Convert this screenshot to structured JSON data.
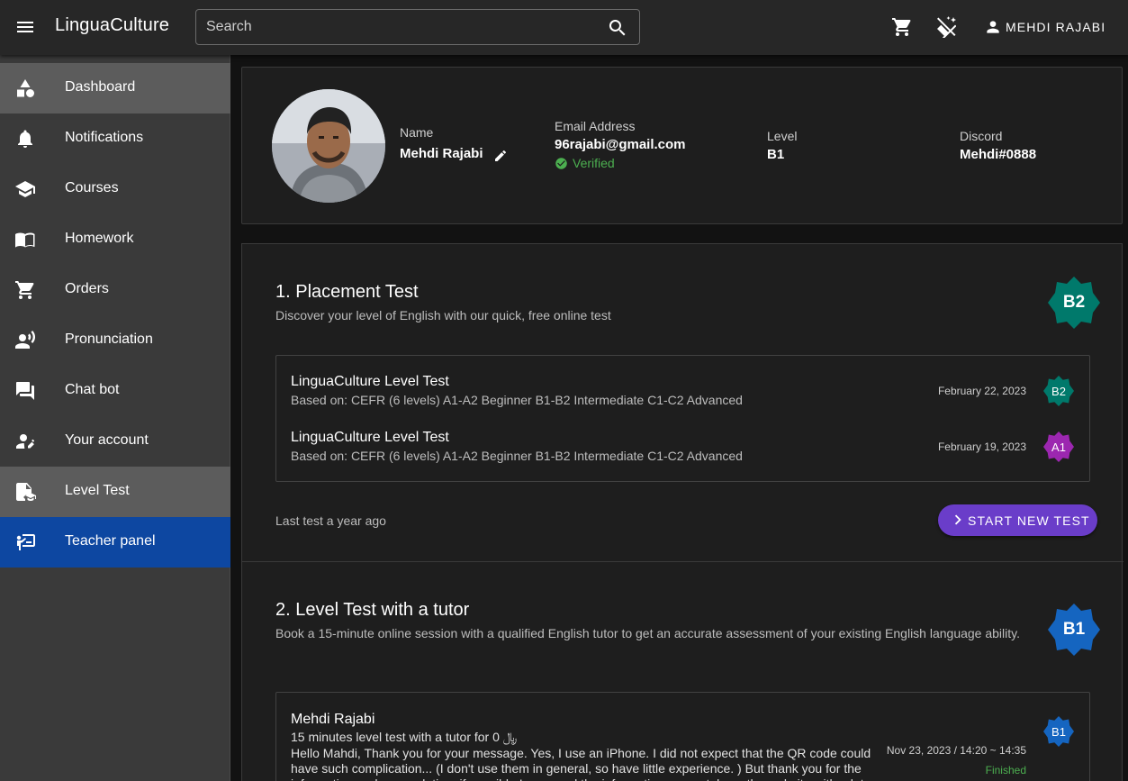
{
  "app": {
    "brand": "LinguaCulture"
  },
  "topbar": {
    "search_placeholder": "Search",
    "user_label": "MEHDI RAJABI"
  },
  "sidebar": {
    "items": [
      {
        "label": "Dashboard",
        "icon": "shapes-icon"
      },
      {
        "label": "Notifications",
        "icon": "bell-icon"
      },
      {
        "label": "Courses",
        "icon": "school-icon"
      },
      {
        "label": "Homework",
        "icon": "book-icon"
      },
      {
        "label": "Orders",
        "icon": "cart-icon"
      },
      {
        "label": "Pronunciation",
        "icon": "voice-icon"
      },
      {
        "label": "Chat bot",
        "icon": "forum-icon"
      },
      {
        "label": "Your account",
        "icon": "person-edit-icon"
      },
      {
        "label": "Level Test",
        "icon": "level-test-icon"
      },
      {
        "label": "Teacher panel",
        "icon": "teacher-icon"
      }
    ]
  },
  "profile": {
    "name_label": "Name",
    "name": "Mehdi Rajabi",
    "email_label": "Email Address",
    "email": "96rajabi@gmail.com",
    "verified": "Verified",
    "level_label": "Level",
    "level": "B1",
    "discord_label": "Discord",
    "discord": "Mehdi#0888"
  },
  "placement": {
    "title": "1. Placement Test",
    "subtitle": "Discover your level of English with our quick, free online test",
    "badge": "B2",
    "tests": [
      {
        "title": "LinguaCulture Level Test",
        "sub": "Based on: CEFR (6 levels) A1-A2 Beginner B1-B2 Intermediate C1-C2 Advanced",
        "date": "February 22, 2023",
        "level": "B2",
        "color": "#00796b"
      },
      {
        "title": "LinguaCulture Level Test",
        "sub": "Based on: CEFR (6 levels) A1-A2 Beginner B1-B2 Intermediate C1-C2 Advanced",
        "date": "February 19, 2023",
        "level": "A1",
        "color": "#9c27b0"
      }
    ],
    "last_test": "Last test a year ago",
    "start_button": "START NEW TEST"
  },
  "tutor": {
    "title": "2. Level Test with a tutor",
    "subtitle": "Book a 15-minute online session with a qualified English tutor to get an accurate assessment of your existing English language ability.",
    "badge": "B1",
    "session": {
      "name": "Mehdi Rajabi",
      "desc": "15 minutes level test with a tutor for 0 ﷼",
      "message": "Hello Mahdi, Thank you for your message. Yes, I use an iPhone. I did not expect that the QR code could have such complication... (I don't use them in general, so have little experience. ) But thank you for the information and your solution, if possible I can send the information separately on the website with a lot of thanks.",
      "datetime": "Nov 23, 2023 / 14:20 ~ 14:35",
      "status": "Finished",
      "level": "B1"
    }
  },
  "colors": {
    "accent": "#0d47a1",
    "button": "#6a3dc9",
    "badge_teal": "#00796b",
    "badge_blue": "#1565c0",
    "badge_purple": "#9c27b0",
    "success": "#4caf50"
  }
}
